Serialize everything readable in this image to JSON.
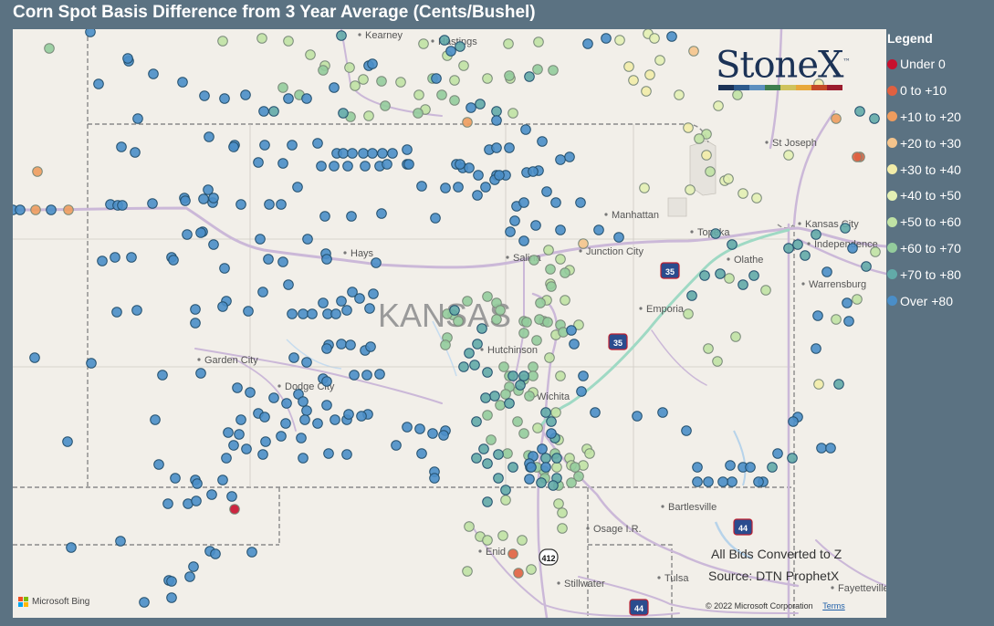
{
  "title": "Corn Spot Basis Difference from 3 Year Average (Cents/Bushel)",
  "legend": {
    "title": "Legend",
    "items": [
      {
        "label": "Under 0",
        "color": "#c8102e"
      },
      {
        "label": "0 to +10",
        "color": "#e06040"
      },
      {
        "label": "+10 to +20",
        "color": "#ee9c5e"
      },
      {
        "label": "+20 to +30",
        "color": "#f5c48c"
      },
      {
        "label": "+30 to +40",
        "color": "#f2eca8"
      },
      {
        "label": "+40 to +50",
        "color": "#e3efb4"
      },
      {
        "label": "+50 to +60",
        "color": "#c0e2a4"
      },
      {
        "label": "+60 to +70",
        "color": "#94cc9c"
      },
      {
        "label": "+70 to +80",
        "color": "#62aaa8"
      },
      {
        "label": "Over +80",
        "color": "#4a8ec8"
      }
    ]
  },
  "brand": {
    "name": "StoneX",
    "trademark": "™",
    "bar_colors": [
      "#1b3256",
      "#2d5a8c",
      "#5d8fbf",
      "#3f7e4d",
      "#cfc35d",
      "#e8a83b",
      "#c44a27",
      "#9b1c2e"
    ]
  },
  "notes": {
    "conversion": "All Bids Converted to Z",
    "source": "Source: DTN ProphetX"
  },
  "attribution": {
    "provider": "Microsoft Bing",
    "copyright": "© 2022 Microsoft Corporation",
    "terms": "Terms"
  },
  "map_labels": {
    "state": "KANSAS",
    "cities": [
      "Kearney",
      "Hastings",
      "St Joseph",
      "Manhattan",
      "Topeka",
      "Kansas City",
      "Independence",
      "Junction City",
      "Salina",
      "Hays",
      "Olathe",
      "Warrensburg",
      "Emporia",
      "Hutchinson",
      "Garden City",
      "Dodge City",
      "Wichita",
      "Bartlesville",
      "Osage I.R.",
      "Enid",
      "Stillwater",
      "Tulsa",
      "Fayetteville"
    ],
    "highways": [
      "35",
      "35",
      "44",
      "44",
      "412"
    ]
  },
  "chart_data": {
    "type": "scatter",
    "categories": [
      "Under 0",
      "0 to +10",
      "+10 to +20",
      "+20 to +30",
      "+30 to +40",
      "+40 to +50",
      "+50 to +60",
      "+60 to +70",
      "+70 to +80",
      "Over +80"
    ],
    "point_counts_approx": [
      1,
      4,
      5,
      2,
      8,
      13,
      55,
      60,
      60,
      230
    ]
  }
}
